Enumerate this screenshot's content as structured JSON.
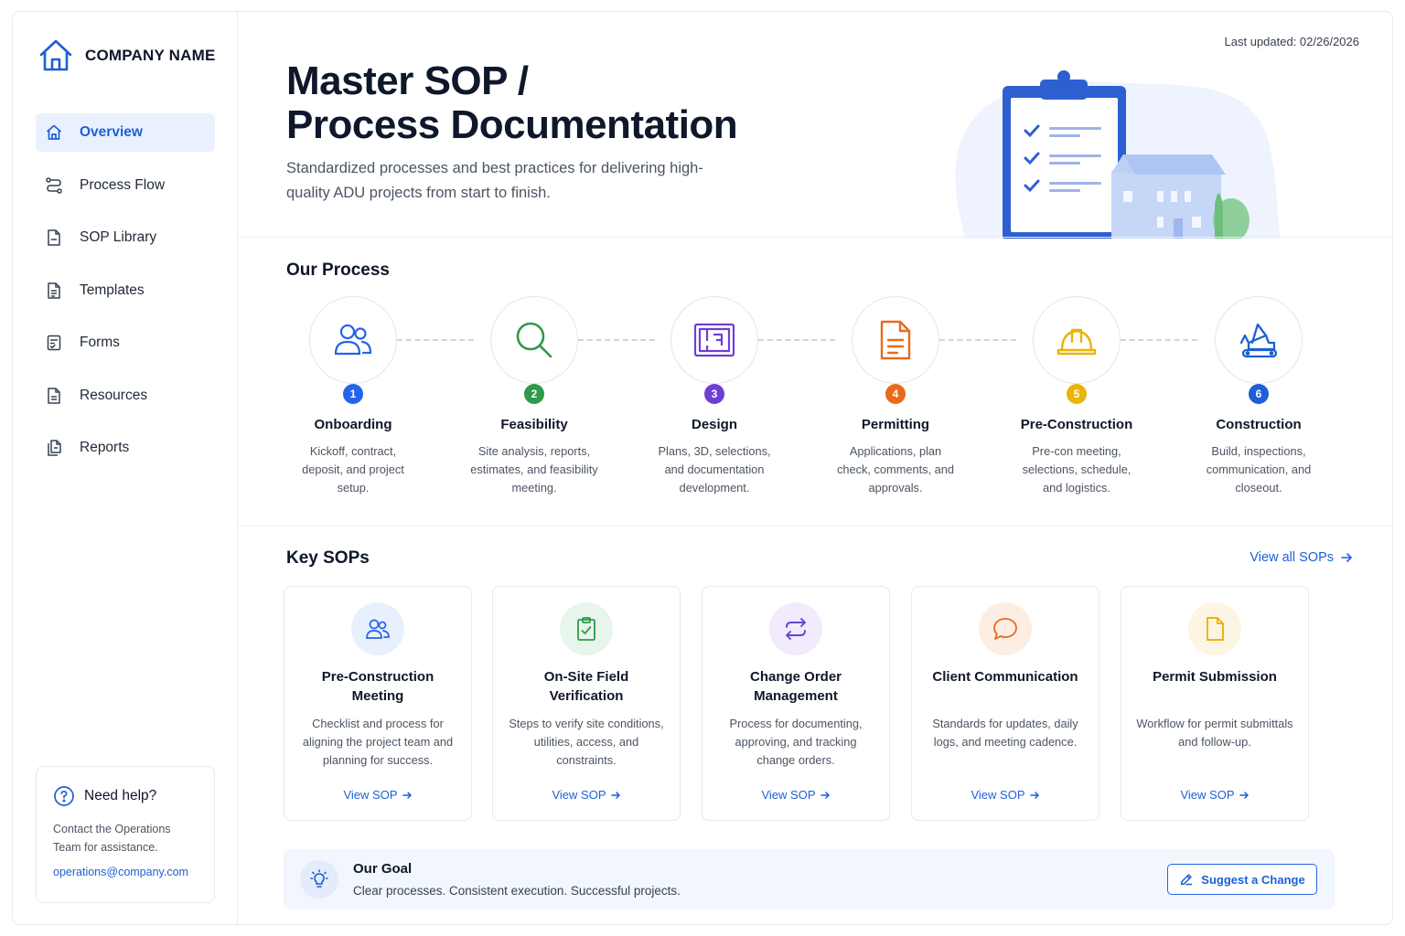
{
  "brand": {
    "name": "COMPANY NAME"
  },
  "nav": [
    {
      "label": "Overview",
      "icon": "home-icon",
      "active": true
    },
    {
      "label": "Process Flow",
      "icon": "flow-icon"
    },
    {
      "label": "SOP Library",
      "icon": "document-icon"
    },
    {
      "label": "Templates",
      "icon": "template-icon"
    },
    {
      "label": "Forms",
      "icon": "form-icon"
    },
    {
      "label": "Resources",
      "icon": "resource-icon"
    },
    {
      "label": "Reports",
      "icon": "reports-icon"
    }
  ],
  "help": {
    "title": "Need help?",
    "text": "Contact the Operations Team for assistance.",
    "email": "operations@company.com"
  },
  "header": {
    "updated": "Last updated: 02/26/2026",
    "title_line1": "Master SOP /",
    "title_line2": "Process Documentation",
    "subtitle": "Standardized processes and best practices for delivering high-quality ADU projects from start to finish."
  },
  "process": {
    "title": "Our Process",
    "steps": [
      {
        "num": "1",
        "title": "Onboarding",
        "desc": "Kickoff, contract, deposit, and project setup.",
        "color": "#2563eb",
        "icon": "users-icon"
      },
      {
        "num": "2",
        "title": "Feasibility",
        "desc": "Site analysis, reports, estimates, and feasibility meeting.",
        "color": "#2e9a4a",
        "icon": "search-icon"
      },
      {
        "num": "3",
        "title": "Design",
        "desc": "Plans, 3D, selections, and documentation development.",
        "color": "#6d3fd4",
        "icon": "blueprint-icon"
      },
      {
        "num": "4",
        "title": "Permitting",
        "desc": "Applications, plan check, comments, and approvals.",
        "color": "#ea6a1c",
        "icon": "permit-document-icon"
      },
      {
        "num": "5",
        "title": "Pre-Construction",
        "desc": "Pre-con meeting, selections, schedule, and logistics.",
        "color": "#eab308",
        "icon": "hard-hat-icon"
      },
      {
        "num": "6",
        "title": "Construction",
        "desc": "Build, inspections, communication, and closeout.",
        "color": "#1d5fd6",
        "icon": "excavator-icon"
      }
    ]
  },
  "sops": {
    "title": "Key SOPs",
    "view_all": "View all SOPs",
    "link_label": "View SOP",
    "items": [
      {
        "title": "Pre-Construction Meeting",
        "desc": "Checklist and process for aligning the project team and planning for success.",
        "icon": "users-icon",
        "bg": "#e9f0fd"
      },
      {
        "title": "On-Site Field Verification",
        "desc": "Steps to verify site conditions, utilities, access, and constraints.",
        "icon": "clipboard-check-icon",
        "bg": "#e8f5ec"
      },
      {
        "title": "Change Order Management",
        "desc": "Process for documenting, approving, and tracking change orders.",
        "icon": "swap-arrows-icon",
        "bg": "#f1ebfd"
      },
      {
        "title": "Client Communication",
        "desc": "Standards for updates, daily logs, and meeting cadence.",
        "icon": "chat-bubble-icon",
        "bg": "#fdeee4"
      },
      {
        "title": "Permit Submission",
        "desc": "Workflow for permit submittals and follow-up.",
        "icon": "file-icon",
        "bg": "#fdf5e3"
      }
    ]
  },
  "goal": {
    "title": "Our Goal",
    "text": "Clear processes. Consistent execution. Successful projects.",
    "button": "Suggest a Change"
  }
}
